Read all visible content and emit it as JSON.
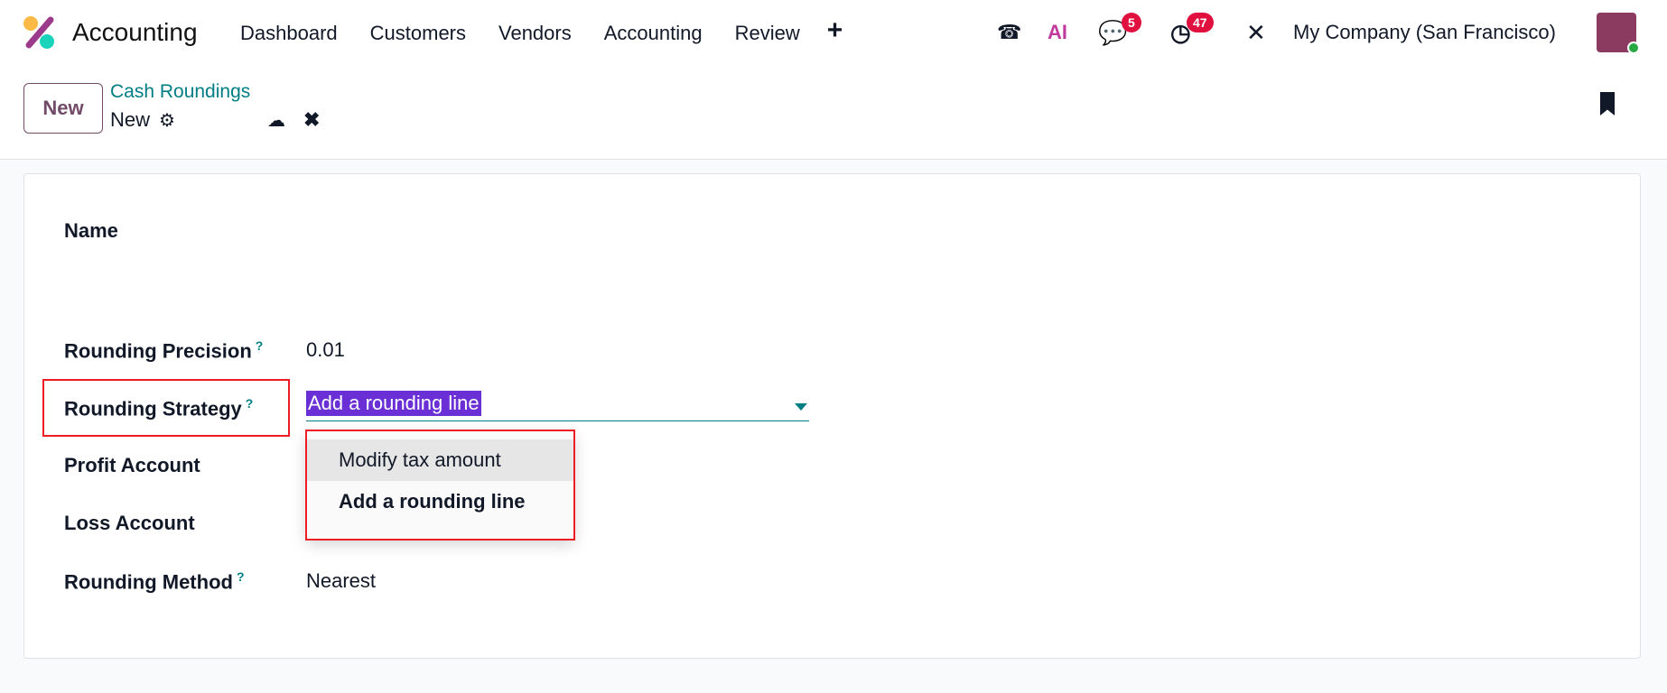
{
  "navbar": {
    "app_name": "Accounting",
    "menu": [
      "Dashboard",
      "Customers",
      "Vendors",
      "Accounting",
      "Review"
    ],
    "plus": "+",
    "ai_label": "AI",
    "messages_count": "5",
    "activities_count": "47",
    "company": "My Company (San Francisco)"
  },
  "control_panel": {
    "new_label": "New",
    "breadcrumb": "Cash Roundings",
    "current": "New"
  },
  "form": {
    "name_label": "Name",
    "precision_label": "Rounding Precision",
    "precision_value": "0.01",
    "strategy_label": "Rounding Strategy",
    "strategy_value": "Add a rounding line",
    "profit_label": "Profit Account",
    "loss_label": "Loss Account",
    "method_label": "Rounding Method",
    "method_value": "Nearest",
    "help": "?",
    "strategy_options": [
      "Modify tax amount",
      "Add a rounding line"
    ]
  },
  "colors": {
    "accent": "#017e84",
    "brand": "#714b67",
    "selection": "#6a30d6",
    "highlight": "#ee1c24"
  }
}
